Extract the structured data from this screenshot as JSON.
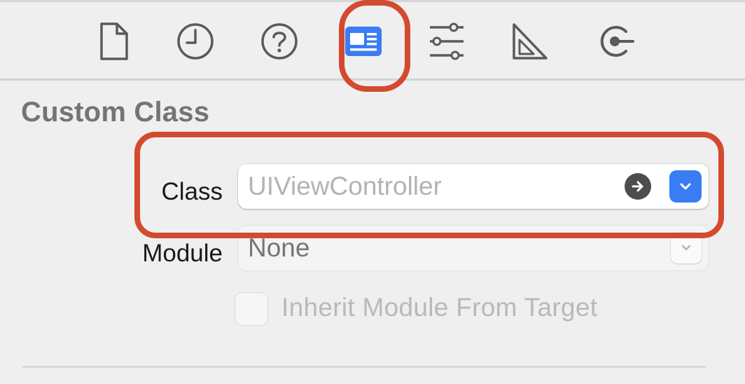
{
  "inspector": {
    "tabs": [
      {
        "name": "file-inspector",
        "icon": "document-icon",
        "selected": false
      },
      {
        "name": "history-inspector",
        "icon": "clock-icon",
        "selected": false
      },
      {
        "name": "quick-help-inspector",
        "icon": "question-icon",
        "selected": false
      },
      {
        "name": "identity-inspector",
        "icon": "identity-card-icon",
        "selected": true
      },
      {
        "name": "attributes-inspector",
        "icon": "sliders-icon",
        "selected": false
      },
      {
        "name": "size-inspector",
        "icon": "ruler-icon",
        "selected": false
      },
      {
        "name": "connections-inspector",
        "icon": "connections-icon",
        "selected": false
      }
    ],
    "accent_color": "#3a7cf3",
    "highlight_color": "#d34a2f"
  },
  "custom_class": {
    "title": "Custom Class",
    "class_label": "Class",
    "class_placeholder": "UIViewController",
    "module_label": "Module",
    "module_placeholder": "None",
    "inherit_label": "Inherit Module From Target",
    "inherit_checked": false
  }
}
